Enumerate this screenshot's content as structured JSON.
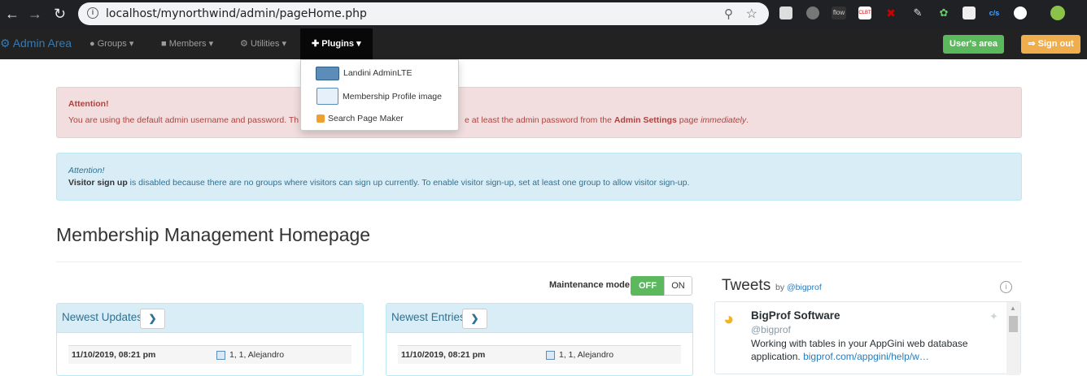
{
  "browser": {
    "url": "localhost/mynorthwind/admin/pageHome.php",
    "ext_labels": {
      "flow": "flow",
      "clbt": "CLBT",
      "cjs": "c/s"
    }
  },
  "navbar": {
    "brand": "Admin Area",
    "groups": "Groups",
    "members": "Members",
    "utilities": "Utilities",
    "plugins": "Plugins",
    "users_area": "User's area",
    "sign_out": "Sign out"
  },
  "plugins_menu": {
    "items": [
      "Landini AdminLTE",
      "Membership Profile image",
      "Search Page Maker"
    ]
  },
  "alert_red": {
    "title": "Attention!",
    "text_start": "You are using the default admin username and password. Th",
    "text_mid": "e at least the admin password from the",
    "bold": "Admin Settings",
    "text_after": "page",
    "italic": "immediately",
    "text_end": "."
  },
  "alert_blue": {
    "title": "Attention!",
    "bold": "Visitor sign up",
    "text": "is disabled because there are no groups where visitors can sign up currently. To enable visitor sign-up, set at least one group to allow visitor sign-up."
  },
  "page_title": "Membership Management Homepage",
  "maintenance": {
    "label": "Maintenance mode",
    "off": "OFF",
    "on": "ON"
  },
  "newest_updates": {
    "title": "Newest Updates",
    "date": "11/10/2019, 08:21 pm",
    "record": "1, 1, Alejandro"
  },
  "newest_entries": {
    "title": "Newest Entries",
    "date": "11/10/2019, 08:21 pm",
    "record": "1, 1, Alejandro"
  },
  "tweets": {
    "title": "Tweets",
    "by": "by",
    "handle_link": "@bigprof",
    "account_name": "BigProf Software",
    "account_handle": "@bigprof",
    "text": "Working with tables in your AppGini web database application.",
    "link": "bigprof.com/appgini/help/w…"
  },
  "colors": {
    "navbar": "#222222",
    "success": "#5cb85c",
    "warning": "#f0ad4e",
    "danger_bg": "#f2dede",
    "info_bg": "#d9edf7",
    "link": "#337ab7"
  }
}
